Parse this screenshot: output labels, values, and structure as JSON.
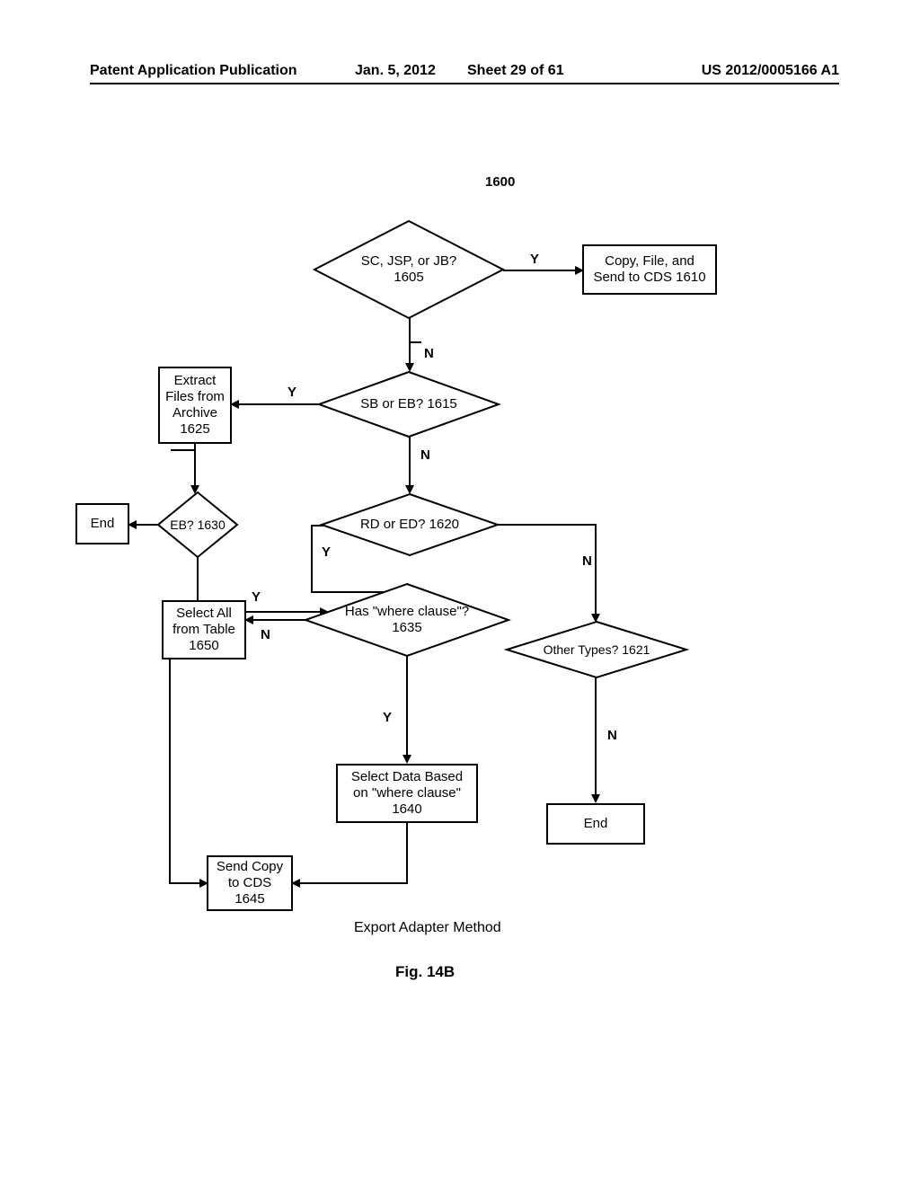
{
  "header": {
    "left": "Patent Application Publication",
    "date": "Jan. 5, 2012",
    "sheet": "Sheet 29 of 61",
    "right": "US 2012/0005166 A1"
  },
  "figure_number_label": "1600",
  "nodes": {
    "d1605": "SC, JSP, or JB?\n1605",
    "r1610": "Copy, File, and\nSend to CDS 1610",
    "d1615": "SB or EB? 1615",
    "d1620": "RD or ED? 1620",
    "d1621": "Other Types? 1621",
    "r1625": "Extract\nFiles from\nArchive\n1625",
    "d1630": "EB?\n1630",
    "end1": "End",
    "d1635": "Has \"where clause\"?\n1635",
    "r1640": "Select Data Based\non \"where clause\"\n1640",
    "r1645": "Send Copy\nto CDS\n1645",
    "r1650": "Select All\nfrom Table\n1650",
    "end2": "End"
  },
  "edge_labels": {
    "y": "Y",
    "n": "N"
  },
  "caption": "Export Adapter Method",
  "figure_label": "Fig. 14B"
}
